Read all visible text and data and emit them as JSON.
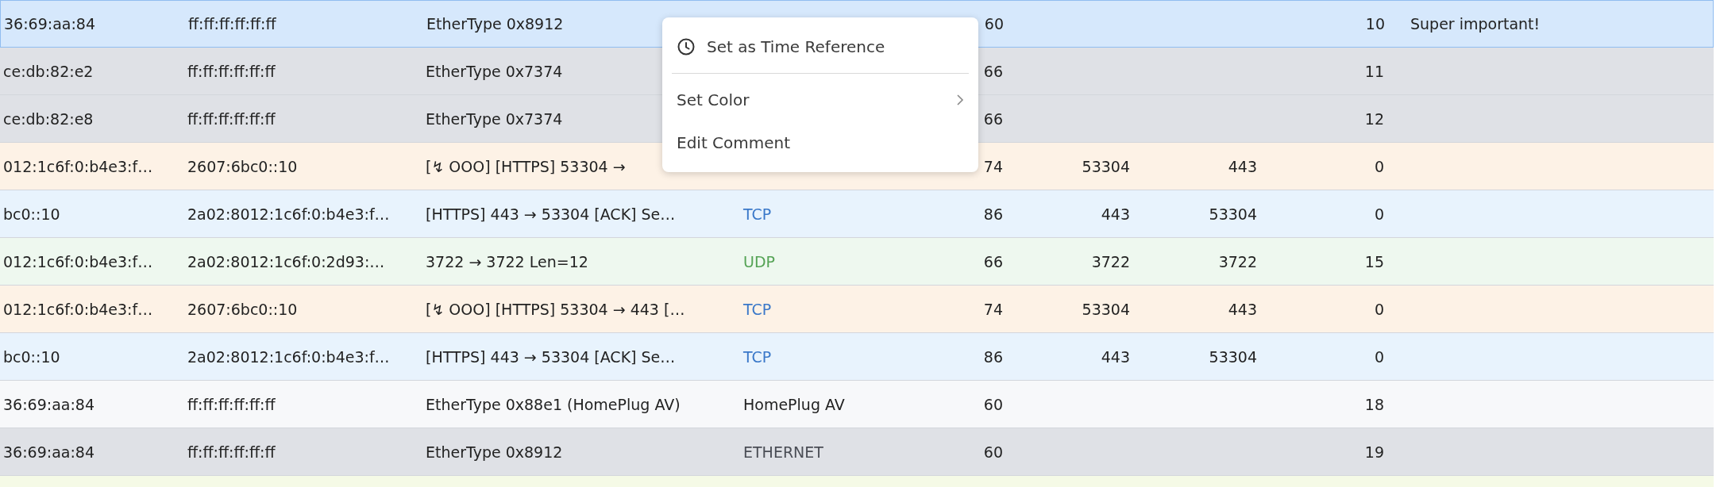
{
  "table": {
    "rows": [
      {
        "selected": true,
        "color": "#d6e8fc",
        "cells": {
          "column_1": "36:69:aa:84",
          "column_2": "ff:ff:ff:ff:ff:ff",
          "column_3": "EtherType 0x8912",
          "column_5": "60",
          "column_8": "10",
          "column_9": "Super important!"
        }
      },
      {
        "selected": false,
        "color": "#dfe1e6",
        "cells": {
          "column_1": "ce:db:82:e2",
          "column_2": "ff:ff:ff:ff:ff:ff",
          "column_3": "EtherType 0x7374",
          "column_5": "66",
          "column_8": "11"
        }
      },
      {
        "selected": false,
        "color": "#dfe1e6",
        "cells": {
          "column_1": "ce:db:82:e8",
          "column_2": "ff:ff:ff:ff:ff:ff",
          "column_3": "EtherType 0x7374",
          "column_5": "66",
          "column_8": "12"
        }
      },
      {
        "selected": false,
        "color": "#fdf2e6",
        "cells": {
          "column_1": "012:1c6f:0:b4e3:f…",
          "column_2": "2607:6bc0::10",
          "column_3": "[↯ OOO] [HTTPS] 53304 →",
          "column_5": "74",
          "column_6": "53304",
          "column_7": "443",
          "column_8": "0"
        }
      },
      {
        "selected": false,
        "color": "#e8f3fd",
        "protocol": {
          "label": "TCP",
          "color": "#3a78c9"
        },
        "cells": {
          "column_1": "bc0::10",
          "column_2": "2a02:8012:1c6f:0:b4e3:f…",
          "column_3": "[HTTPS] 443 → 53304 [ACK] Se…",
          "column_5": "86",
          "column_6": "443",
          "column_7": "53304",
          "column_8": "0"
        }
      },
      {
        "selected": false,
        "color": "#eef8ef",
        "protocol": {
          "label": "UDP",
          "color": "#55a355"
        },
        "cells": {
          "column_1": "012:1c6f:0:b4e3:f…",
          "column_2": "2a02:8012:1c6f:0:2d93:…",
          "column_3": "3722 → 3722 Len=12",
          "column_5": "66",
          "column_6": "3722",
          "column_7": "3722",
          "column_8": "15"
        }
      },
      {
        "selected": false,
        "color": "#fdf2e6",
        "protocol": {
          "label": "TCP",
          "color": "#3a78c9"
        },
        "cells": {
          "column_1": "012:1c6f:0:b4e3:f…",
          "column_2": "2607:6bc0::10",
          "column_3": "[↯ OOO] [HTTPS] 53304 → 443 […",
          "column_5": "74",
          "column_6": "53304",
          "column_7": "443",
          "column_8": "0"
        }
      },
      {
        "selected": false,
        "color": "#e8f3fd",
        "protocol": {
          "label": "TCP",
          "color": "#3a78c9"
        },
        "cells": {
          "column_1": "bc0::10",
          "column_2": "2a02:8012:1c6f:0:b4e3:f…",
          "column_3": "[HTTPS] 443 → 53304 [ACK] Se…",
          "column_5": "86",
          "column_6": "443",
          "column_7": "53304",
          "column_8": "0"
        }
      },
      {
        "selected": false,
        "color": "#f7f8fa",
        "protocol": {
          "label": "HomePlug AV",
          "color": "#222222"
        },
        "cells": {
          "column_1": "36:69:aa:84",
          "column_2": "ff:ff:ff:ff:ff:ff",
          "column_3": "EtherType 0x88e1 (HomePlug AV)",
          "column_5": "60",
          "column_8": "18"
        }
      },
      {
        "selected": false,
        "color": "#dfe1e6",
        "protocol": {
          "label": "ETHERNET",
          "color": "#4a4d55"
        },
        "cells": {
          "column_1": "36:69:aa:84",
          "column_2": "ff:ff:ff:ff:ff:ff",
          "column_3": "EtherType 0x8912",
          "column_5": "60",
          "column_8": "19"
        }
      },
      {
        "selected": false,
        "color": "#f5fae6",
        "cells": {}
      }
    ]
  },
  "context_menu": {
    "items": [
      {
        "label": "Set as Time Reference",
        "kind": "clock",
        "separator_after": true
      },
      {
        "label": "Set Color",
        "kind": "submenu",
        "separator_after": false
      },
      {
        "label": "Edit Comment",
        "kind": "plain",
        "separator_after": false
      }
    ]
  }
}
